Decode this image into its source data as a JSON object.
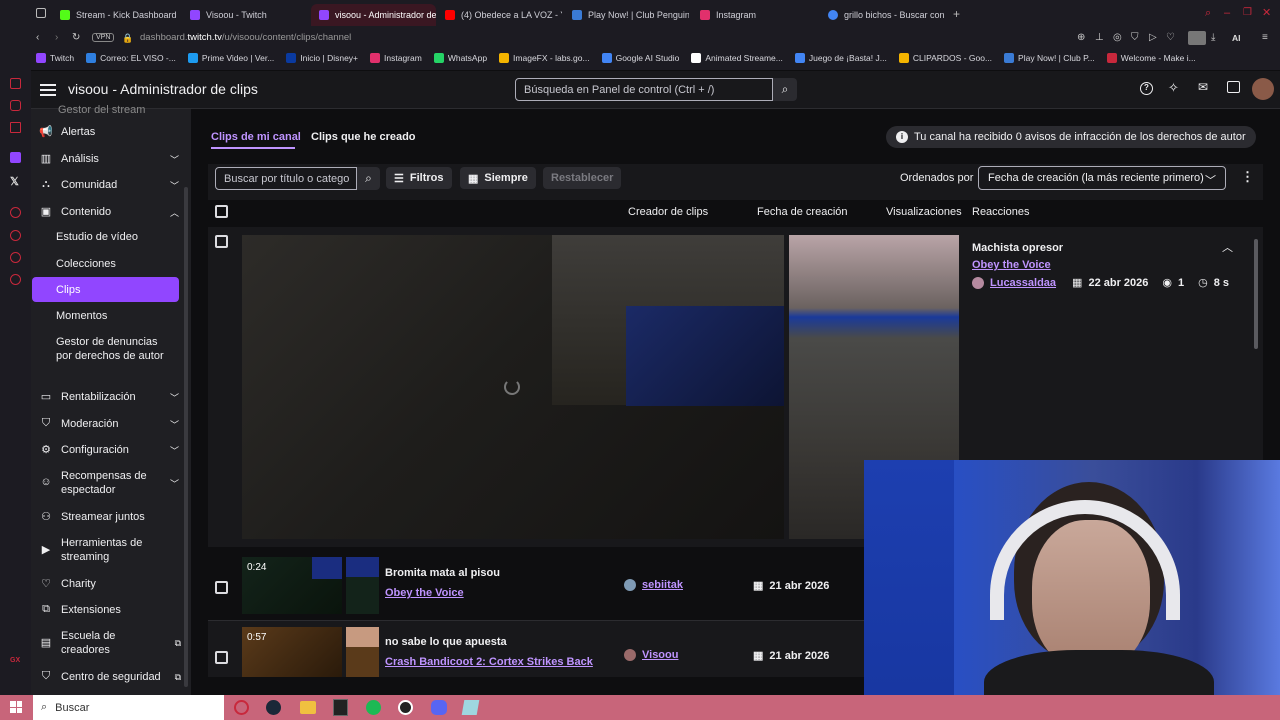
{
  "browser": {
    "tabs": [
      {
        "label": "Stream - Kick Dashboard",
        "color": "#53fc18"
      },
      {
        "label": "Visoou - Twitch",
        "color": "#9146ff"
      },
      {
        "label": "visoou - Administrador de",
        "color": "#9146ff"
      },
      {
        "label": "(4) Obedece a LA VOZ - Y",
        "color": "#ff0000"
      },
      {
        "label": "Play Now! | Club Penguin",
        "color": "#3a7bd5"
      },
      {
        "label": "Instagram",
        "color": "#e1306c"
      },
      {
        "label": "grillo bichos - Buscar con",
        "color": "#4285f4"
      }
    ],
    "vpn_label": "VPN",
    "url_prefix": "dashboard.",
    "url_domain": "twitch.tv",
    "url_path": "/u/visoou/content/clips/channel",
    "ai_label": "AI",
    "bookmarks": [
      "Twitch",
      "Correo: EL VISO -...",
      "Prime Video | Ver...",
      "Inicio | Disney+",
      "Instagram",
      "WhatsApp",
      "ImageFX - labs.go...",
      "Google AI Studio",
      "Animated Streame...",
      "Juego de ¡Basta! J...",
      "CLIPARDOS - Goo...",
      "Play Now! | Club P...",
      "Welcome - Make i..."
    ]
  },
  "header": {
    "title": "visoou - Administrador de clips",
    "search_placeholder": "Búsqueda en Panel de control (Ctrl + /)"
  },
  "sidebar": {
    "partial_top": "Gestor del stream",
    "items": [
      {
        "label": "Alertas",
        "icon": "megaphone-icon",
        "chevron": ""
      },
      {
        "label": "Análisis",
        "icon": "chart-icon",
        "chevron": "down"
      },
      {
        "label": "Comunidad",
        "icon": "community-icon",
        "chevron": "down"
      },
      {
        "label": "Contenido",
        "icon": "content-icon",
        "chevron": "up"
      }
    ],
    "sub_items": [
      "Estudio de vídeo",
      "Colecciones",
      "Clips",
      "Momentos",
      "Gestor de denuncias por derechos de autor"
    ],
    "items2": [
      {
        "label": "Rentabilización",
        "icon": "money-icon",
        "chevron": "down"
      },
      {
        "label": "Moderación",
        "icon": "shield-icon",
        "chevron": "down"
      },
      {
        "label": "Configuración",
        "icon": "gear-icon",
        "chevron": "down"
      },
      {
        "label": "Recompensas de espectador",
        "icon": "rewards-icon",
        "chevron": "down"
      },
      {
        "label": "Streamear juntos",
        "icon": "stream-together-icon",
        "chevron": ""
      },
      {
        "label": "Herramientas de streaming",
        "icon": "tools-icon",
        "chevron": ""
      },
      {
        "label": "Charity",
        "icon": "charity-icon",
        "chevron": ""
      },
      {
        "label": "Extensiones",
        "icon": "extensions-icon",
        "chevron": ""
      },
      {
        "label": "Escuela de creadores",
        "icon": "school-icon",
        "chevron": "external"
      },
      {
        "label": "Centro de seguridad",
        "icon": "safety-icon",
        "chevron": "external"
      }
    ]
  },
  "content": {
    "tabs": [
      "Clips de mi canal",
      "Clips que he creado"
    ],
    "notice": "Tu canal ha recibido 0 avisos de infracción de los derechos de autor",
    "filter_placeholder": "Buscar por título o catego",
    "filters_label": "Filtros",
    "always_label": "Siempre",
    "reset_label": "Restablecer",
    "sort_label": "Ordenados por",
    "sort_value": "Fecha de creación (la más reciente primero)",
    "columns": [
      "Creador de clips",
      "Fecha de creación",
      "Visualizaciones",
      "Reacciones"
    ],
    "expanded": {
      "title": "Machista opresor",
      "game": "Obey the Voice",
      "creator": "Lucassaldaa",
      "date": "22 abr 2026",
      "views": "1",
      "duration": "8 s"
    },
    "rows": [
      {
        "duration": "0:24",
        "title": "Bromita mata al pisou",
        "game": "Obey the Voice",
        "creator": "sebiitak",
        "date": "21 abr 2026"
      },
      {
        "duration": "0:57",
        "title": "no sabe lo que apuesta",
        "game": "Crash Bandicoot 2: Cortex Strikes Back",
        "creator": "Visoou",
        "date": "21 abr 2026"
      }
    ]
  },
  "taskbar": {
    "search_label": "Buscar"
  },
  "colors": {
    "accent": "#9146ff",
    "link": "#bf94ff",
    "brand_red": "#c8283c"
  }
}
